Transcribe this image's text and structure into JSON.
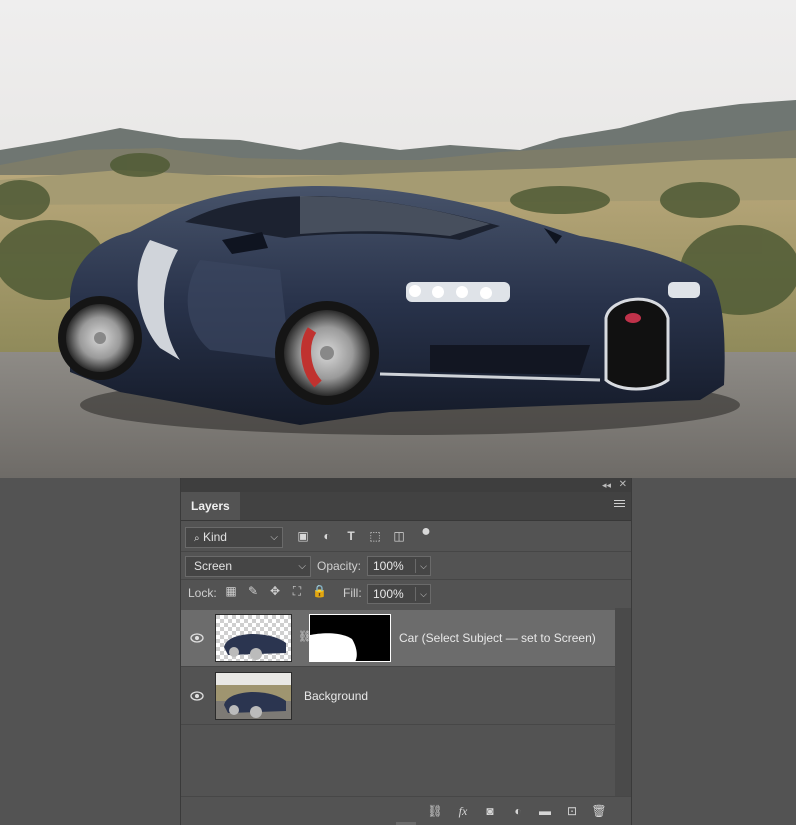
{
  "panel": {
    "tab_label": "Layers",
    "filter": {
      "kind_label": "Kind",
      "search_icon": "search-icon"
    },
    "blend_mode": "Screen",
    "opacity_label": "Opacity:",
    "opacity_value": "100%",
    "lock_label": "Lock:",
    "fill_label": "Fill:",
    "fill_value": "100%",
    "filter_icons": [
      "image-filter-icon",
      "adjustment-filter-icon",
      "type-filter-icon",
      "shape-filter-icon",
      "smart-object-filter-icon",
      "filter-toggle-icon"
    ],
    "lock_icons": [
      "lock-transparent-pixels-icon",
      "lock-image-pixels-icon",
      "lock-position-icon",
      "lock-artboard-icon",
      "lock-all-icon"
    ],
    "layers": [
      {
        "name": "Car (Select Subject — set to Screen)",
        "visible": true,
        "selected": true,
        "has_mask": true
      },
      {
        "name": "Background",
        "visible": true,
        "selected": false,
        "has_mask": false
      }
    ],
    "bottom_icons": [
      "link-layers-icon",
      "layer-style-icon",
      "add-mask-icon",
      "adjustment-layer-icon",
      "new-group-icon",
      "new-layer-icon",
      "delete-layer-icon"
    ]
  }
}
